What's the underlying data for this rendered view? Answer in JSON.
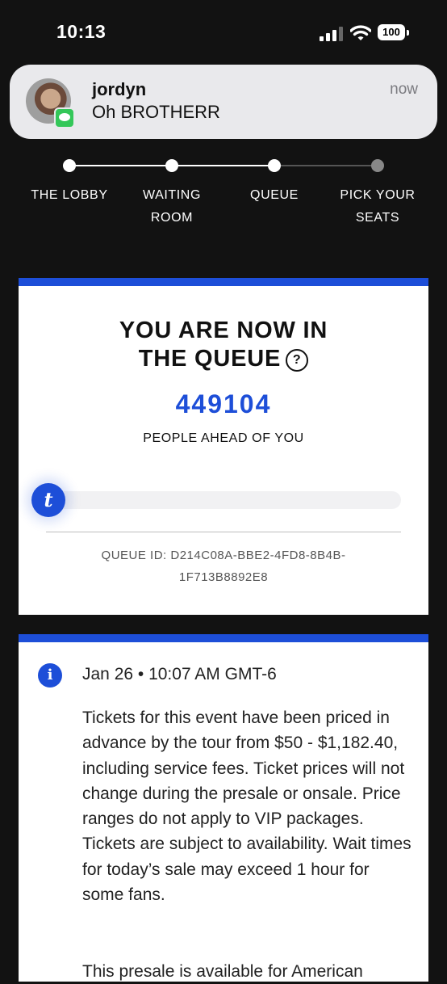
{
  "status_bar": {
    "time": "10:13",
    "battery": "100"
  },
  "notification": {
    "sender": "jordyn",
    "message": "Oh BROTHERR",
    "time": "now",
    "app_icon": "messages-icon"
  },
  "stepper": {
    "steps": [
      {
        "line1": "THE LOBBY",
        "line2": "",
        "state": "complete"
      },
      {
        "line1": "WAITING",
        "line2": "ROOM",
        "state": "complete"
      },
      {
        "line1": "QUEUE",
        "line2": "",
        "state": "current"
      },
      {
        "line1": "PICK YOUR",
        "line2": "SEATS",
        "state": "pending"
      }
    ]
  },
  "queue_card": {
    "title_line1": "YOU ARE NOW IN",
    "title_line2": "THE QUEUE",
    "help_glyph": "?",
    "people_ahead": "449104",
    "people_ahead_label": "PEOPLE AHEAD OF YOU",
    "progress_fraction": 0.02,
    "handle_glyph": "t",
    "queue_id_line1": "QUEUE ID: D214C08A-BBE2-4FD8-8B4B-",
    "queue_id_line2": "1F713B8892E8"
  },
  "info_card": {
    "icon_glyph": "i",
    "date": "Jan 26 • 10:07 AM GMT-6",
    "body": "Tickets for this event have been priced in advance by the tour from $50 - $1,182.40, including service fees. Ticket prices will not change during the presale or onsale. Price ranges do not apply to VIP packages. Tickets are subject to availability. Wait times for today’s sale may exceed 1 hour for some fans.",
    "body_2": "This presale is available for American"
  },
  "colors": {
    "accent_blue": "#1d4ed8",
    "background": "#121212",
    "card": "#ffffff",
    "notification_bg": "#e9e9ec"
  }
}
